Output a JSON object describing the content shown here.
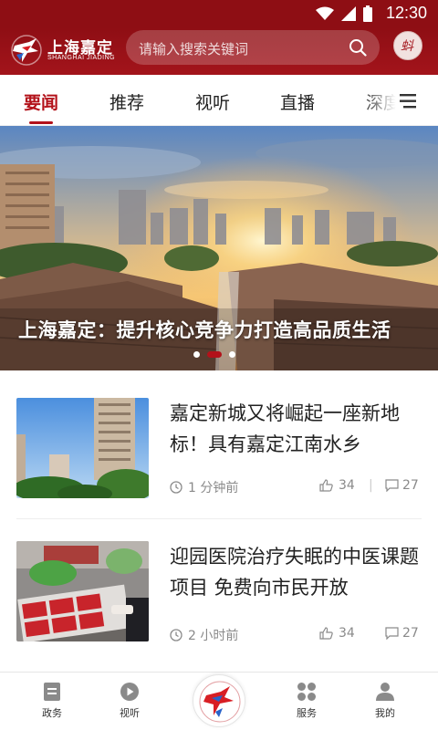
{
  "status_bar": {
    "time": "12:30"
  },
  "header": {
    "logo_cn": "上海嘉定",
    "logo_en": "SHANGHAI JIADING",
    "search_placeholder": "请输入搜索关键词",
    "avatar_char": "蚪"
  },
  "tabs": [
    {
      "label": "要闻",
      "active": true
    },
    {
      "label": "推荐",
      "active": false
    },
    {
      "label": "视听",
      "active": false
    },
    {
      "label": "直播",
      "active": false
    },
    {
      "label": "深度",
      "active": false
    }
  ],
  "banner": {
    "caption": "上海嘉定：提升核心竞争力打造高品质生活",
    "slide_count": 3,
    "active_slide": 2
  },
  "news": [
    {
      "title": "嘉定新城又将崛起一座新地标！具有嘉定江南水乡",
      "time": "1 分钟前",
      "likes": "34",
      "comments": "27",
      "thumb_icon": "high-rise-photo"
    },
    {
      "title": "迎园医院治疗失眠的中医课题项目 免费向市民开放",
      "time": "2 小时前",
      "likes": "34",
      "comments": "27",
      "thumb_icon": "hospital-kiosk-photo"
    }
  ],
  "bottom_nav": [
    {
      "label": "政务",
      "icon": "document-icon"
    },
    {
      "label": "视听",
      "icon": "play-icon"
    },
    {
      "label": "",
      "icon": "home-logo-icon"
    },
    {
      "label": "服务",
      "icon": "grid-icon"
    },
    {
      "label": "我的",
      "icon": "person-icon"
    }
  ],
  "colors": {
    "brand_red": "#b3121a",
    "header_red": "#8e0e14"
  }
}
